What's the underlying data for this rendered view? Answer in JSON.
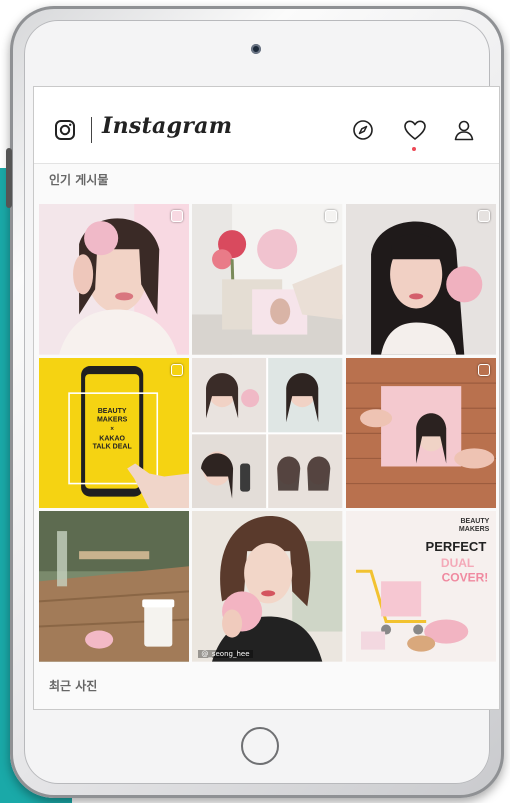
{
  "app": {
    "brand": "Instagram",
    "header_icons": [
      "instagram-glyph-icon",
      "compass-icon",
      "heart-icon",
      "profile-icon"
    ]
  },
  "sections": {
    "popular_label": "인기 게시물",
    "recent_label": "최근 사진"
  },
  "posts": [
    {
      "alt": "woman holding pink cushion compact",
      "type": "multi"
    },
    {
      "alt": "pink product box and flowers",
      "type": "multi"
    },
    {
      "alt": "woman holding pink compact",
      "type": "multi"
    },
    {
      "alt": "phone promo",
      "type": "multi",
      "text": [
        "BEAUTY",
        "MAKERS",
        "×",
        "KAKAO",
        "TALK DEAL"
      ]
    },
    {
      "alt": "photo collage of women",
      "type": "single"
    },
    {
      "alt": "pink box on brick wall",
      "type": "multi"
    },
    {
      "alt": "coffee cup and compact on table",
      "type": "single"
    },
    {
      "alt": "woman holding compact",
      "type": "single",
      "handle": "@_seong_hee"
    },
    {
      "alt": "product promo",
      "type": "single",
      "text": [
        "BEAUTY",
        "MAKERS",
        "PERFECT",
        "DUAL",
        "COVER!"
      ]
    }
  ],
  "colors": {
    "accent_teal": "#1aa9a8",
    "notif_red": "#ed4956",
    "promo_yellow": "#f5d312",
    "brand_pink": "#f2b8c6"
  }
}
